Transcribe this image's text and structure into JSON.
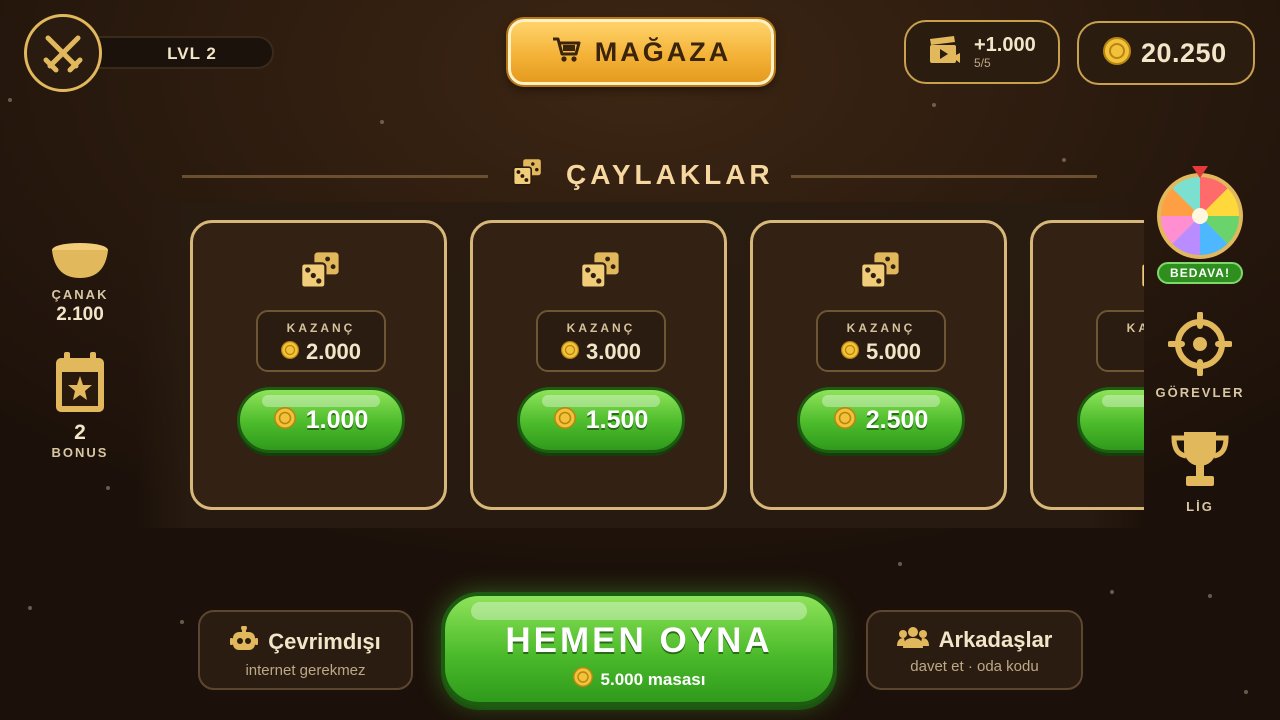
{
  "header": {
    "level_label": "LVL 2",
    "store_label": "MAĞAZA",
    "reward": {
      "amount": "+1.000",
      "count": "5/5"
    },
    "coins": "20.250"
  },
  "section": {
    "title": "ÇAYLAKLAR"
  },
  "tables": [
    {
      "win_label": "KAZANÇ",
      "win": "2.000",
      "buy_in": "1.000"
    },
    {
      "win_label": "KAZANÇ",
      "win": "3.000",
      "buy_in": "1.500"
    },
    {
      "win_label": "KAZANÇ",
      "win": "5.000",
      "buy_in": "2.500"
    },
    {
      "win_label": "KAZANÇ",
      "win": "",
      "buy_in": ""
    }
  ],
  "left_panel": {
    "pot": {
      "label": "ÇANAK",
      "value": "2.100"
    },
    "bonus": {
      "count": "2",
      "label": "BONUS"
    }
  },
  "right_panel": {
    "wheel_badge": "BEDAVA!",
    "missions_label": "GÖREVLER",
    "league_label": "LİG"
  },
  "bottom": {
    "offline": {
      "title": "Çevrimdışı",
      "subtitle": "internet gerekmez"
    },
    "play": {
      "title": "HEMEN OYNA",
      "subtitle": "5.000 masası"
    },
    "friends": {
      "title": "Arkadaşlar",
      "subtitle": "davet et · oda kodu"
    }
  },
  "colors": {
    "gold": "#e2b85c",
    "green": "#4cbb2b",
    "bg": "#2a1a0e"
  }
}
